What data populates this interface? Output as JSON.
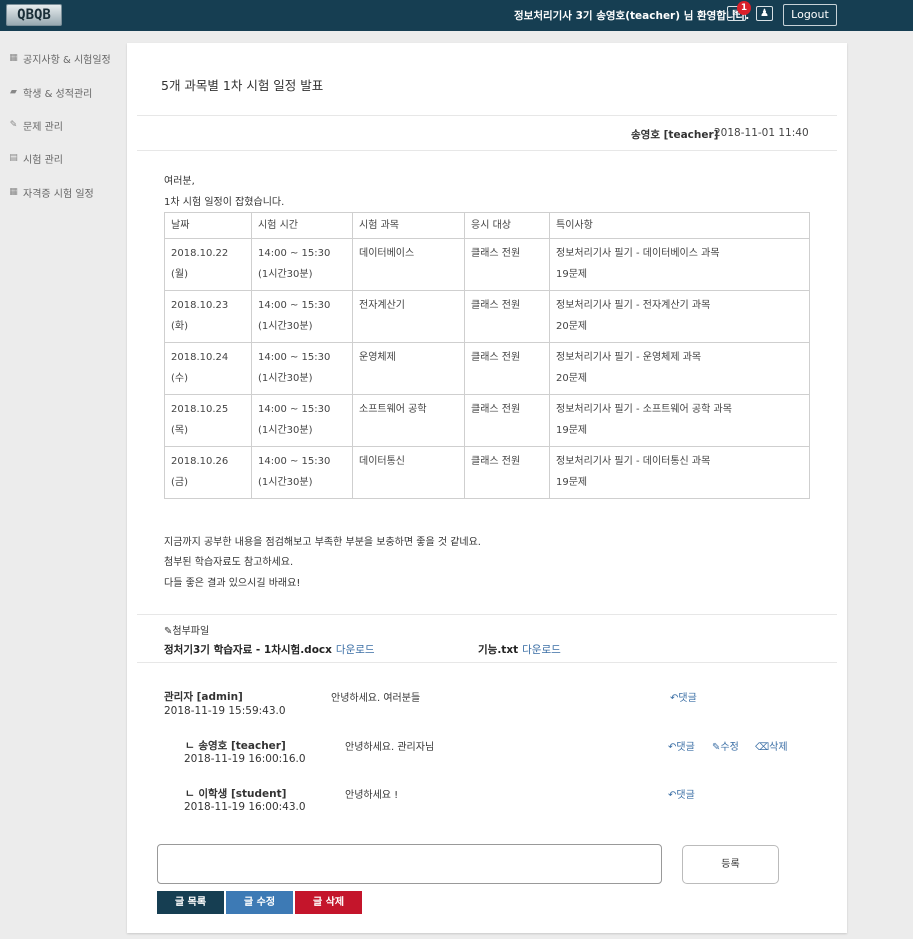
{
  "header": {
    "logo_text": "QBQB",
    "welcome": "정보처리기사 3기 송영호(teacher) 님 환영합니다.",
    "mail_icon": "envelope-icon",
    "mail_badge": "1",
    "user_icon": "user-icon",
    "logout_label": "Logout"
  },
  "sidebar": {
    "items": [
      {
        "icon": "calendar-icon",
        "glyph": "▦",
        "label": "공지사항 & 시험일정"
      },
      {
        "icon": "book-icon",
        "glyph": "▰",
        "label": "학생 & 성적관리"
      },
      {
        "icon": "pencil-icon",
        "glyph": "✎",
        "label": "문제 관리"
      },
      {
        "icon": "document-icon",
        "glyph": "▤",
        "label": "시험 관리"
      },
      {
        "icon": "calendar-icon",
        "glyph": "▦",
        "label": "자격증 시험 일정"
      }
    ]
  },
  "post": {
    "title": "5개 과목별 1차 시험 일정 발표",
    "author": "송영호 [teacher]",
    "date": "2018-11-01 11:40",
    "intro": [
      "여러분,",
      "1차 시험 일정이 잡혔습니다."
    ],
    "table": {
      "headers": [
        "날짜",
        "시험 시간",
        "시험 과목",
        "응시 대상",
        "특이사항"
      ],
      "rows": [
        {
          "date": "2018.10.22",
          "day": "(월)",
          "time": "14:00 ~ 15:30",
          "duration": "(1시간30분)",
          "subject": "데이터베이스",
          "target": "클래스 전원",
          "note": "정보처리기사 필기 - 데이터베이스 과목",
          "count": "19문제"
        },
        {
          "date": "2018.10.23",
          "day": "(화)",
          "time": "14:00 ~ 15:30",
          "duration": "(1시간30분)",
          "subject": "전자계산기",
          "target": "클래스 전원",
          "note": "정보처리기사 필기 - 전자계산기 과목",
          "count": "20문제"
        },
        {
          "date": "2018.10.24",
          "day": "(수)",
          "time": "14:00 ~ 15:30",
          "duration": "(1시간30분)",
          "subject": "운영체제",
          "target": "클래스 전원",
          "note": "정보처리기사 필기 - 운영체제 과목",
          "count": "20문제"
        },
        {
          "date": "2018.10.25",
          "day": "(목)",
          "time": "14:00 ~ 15:30",
          "duration": "(1시간30분)",
          "subject": "소프트웨어 공학",
          "target": "클래스 전원",
          "note": "정보처리기사 필기 - 소프트웨어 공학 과목",
          "count": "19문제"
        },
        {
          "date": "2018.10.26",
          "day": "(금)",
          "time": "14:00 ~ 15:30",
          "duration": "(1시간30분)",
          "subject": "데이터통신",
          "target": "클래스 전원",
          "note": "정보처리기사 필기 - 데이터통신 과목",
          "count": "19문제"
        }
      ]
    },
    "outro": [
      "지금까지 공부한 내용을 점검해보고 부족한 부분을 보충하면 좋을 것 같네요.",
      "첨부된 학습자료도 참고하세요.",
      "다들 좋은 결과 있으시길 바래요!"
    ]
  },
  "attachments": {
    "label": "첨부파일",
    "icon": "paperclip-icon",
    "files": [
      {
        "name": "정처기3기 학습자료 - 1차시험.docx",
        "download": "다운로드"
      },
      {
        "name": "기능.txt",
        "download": "다운로드"
      }
    ]
  },
  "comments": [
    {
      "author": "관리자 [admin]",
      "date": "2018-11-19 15:59:43.0",
      "text": "안녕하세요. 여러분들",
      "reply": "댓글"
    },
    {
      "author": "ㄴ 송영호 [teacher]",
      "date": "2018-11-19 16:00:16.0",
      "text": "안녕하세요. 관리자님",
      "reply": "댓글",
      "edit": "수정",
      "delete": "삭제"
    },
    {
      "author": "ㄴ 이학생 [student]",
      "date": "2018-11-19 16:00:43.0",
      "text": "안녕하세요 !",
      "reply": "댓글"
    }
  ],
  "comment_form": {
    "placeholder": "",
    "submit_label": "등록"
  },
  "actions": {
    "list_label": "글 목록",
    "edit_label": "글 수정",
    "delete_label": "글 삭제"
  },
  "colors": {
    "header": "#163e52",
    "link": "#3a6ea5",
    "edit_button": "#3d7ab5",
    "delete_button": "#c4152b",
    "badge": "#d9202a"
  }
}
